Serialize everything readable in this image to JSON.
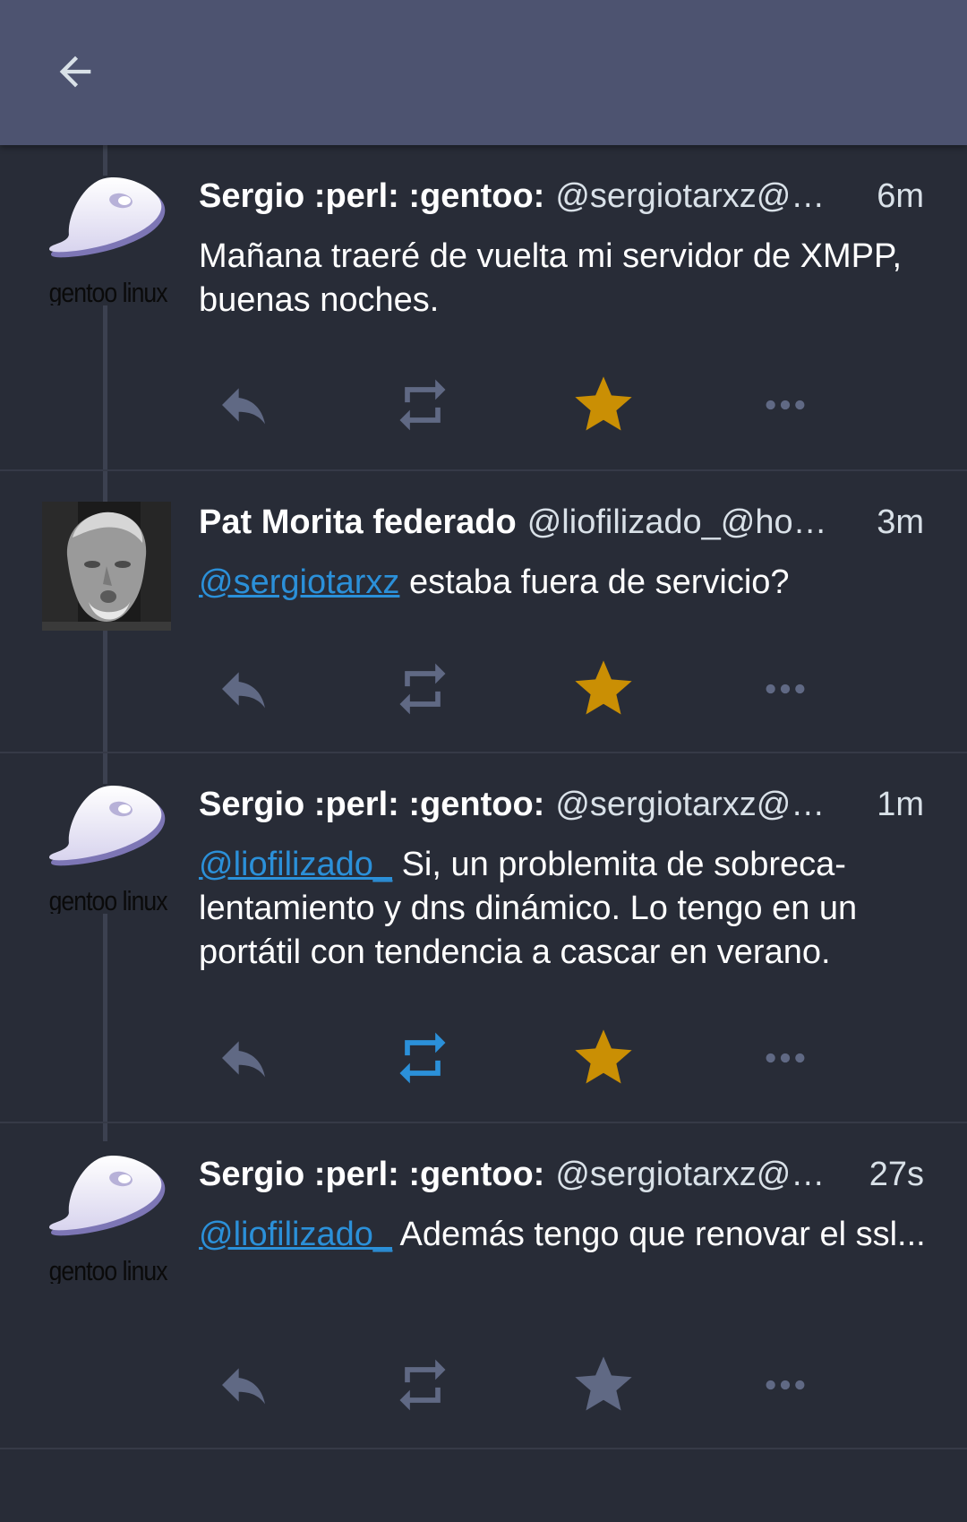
{
  "appbar": {
    "back_icon": "arrow-left-icon"
  },
  "colors": {
    "background": "#282c37",
    "appbar": "#4d5370",
    "icon_default": "#606984",
    "favourited": "#ca8f04",
    "boosted": "#2b90d9",
    "mention": "#2b90d9"
  },
  "avatars": {
    "gentoo": {
      "caption": "gentoo linux",
      "icon": "gentoo-logo"
    },
    "pat": {
      "icon": "person-photo"
    }
  },
  "statuses": [
    {
      "display_name": "Sergio :perl: :gentoo:",
      "acct": "@sergiotarxz@…",
      "time": "6m",
      "mention": "",
      "text": "Mañana traeré de vuelta mi servidor de XMPP, buenas noches.",
      "favourited": true,
      "boosted": false
    },
    {
      "display_name": "Pat Morita federado",
      "acct": "@liofilizado_@ho…",
      "time": "3m",
      "mention": "@sergiotarxz",
      "text": " estaba fuera de servicio?",
      "favourited": true,
      "boosted": false
    },
    {
      "display_name": "Sergio :perl: :gentoo:",
      "acct": "@sergiotarxz@…",
      "time": "1m",
      "mention": "@liofilizado_",
      "text": " Si, un problemita de sobreca­lentamiento y dns dinámico. Lo tengo en un portátil con tendencia a cascar en verano.",
      "favourited": true,
      "boosted": true
    },
    {
      "display_name": "Sergio :perl: :gentoo:",
      "acct": "@sergiotarxz@…",
      "time": "27s",
      "mention": "@liofilizado_",
      "text": " Además tengo que renovar el ssl...",
      "favourited": false,
      "boosted": false
    }
  ]
}
